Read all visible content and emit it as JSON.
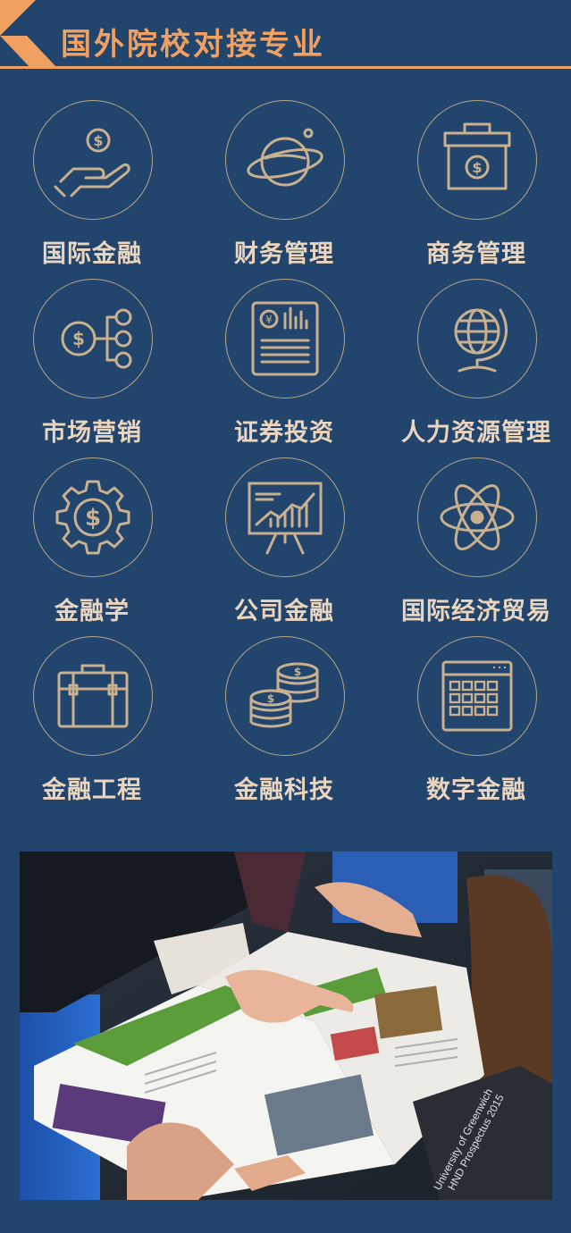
{
  "header": {
    "title": "国外院校对接专业"
  },
  "majors": [
    {
      "label": "国际金融",
      "icon": "hand-coin-icon"
    },
    {
      "label": "财务管理",
      "icon": "planet-icon"
    },
    {
      "label": "商务管理",
      "icon": "cashbox-icon"
    },
    {
      "label": "市场营销",
      "icon": "coin-network-icon"
    },
    {
      "label": "证券投资",
      "icon": "report-chart-icon"
    },
    {
      "label": "人力资源管理",
      "icon": "globe-icon"
    },
    {
      "label": "金融学",
      "icon": "gear-dollar-icon"
    },
    {
      "label": "公司金融",
      "icon": "presentation-chart-icon"
    },
    {
      "label": "国际经济贸易",
      "icon": "atom-icon"
    },
    {
      "label": "金融工程",
      "icon": "briefcase-icon"
    },
    {
      "label": "金融科技",
      "icon": "coin-stacks-icon"
    },
    {
      "label": "数字金融",
      "icon": "calendar-grid-icon"
    }
  ],
  "photo": {
    "brochure_text": [
      "University of Greenwich",
      "HND Prospectus 2015"
    ]
  },
  "colors": {
    "background": "#22456d",
    "accent": "#f0a060",
    "icon": "#c9b08e",
    "label": "#ecd5bd"
  }
}
